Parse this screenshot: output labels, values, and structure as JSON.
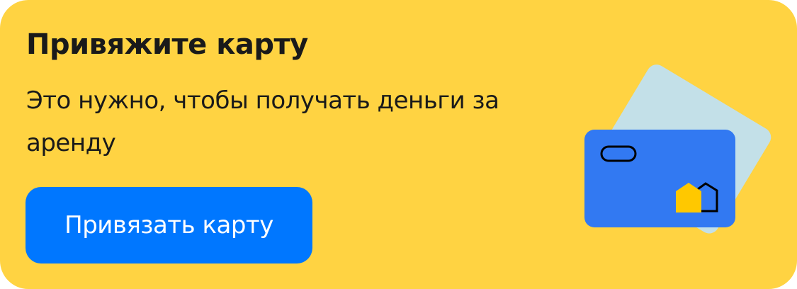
{
  "banner": {
    "title": "Привяжите карту",
    "subtitle": "Это нужно, чтобы получать деньги за аренду",
    "button_label": "Привязать карту"
  },
  "colors": {
    "background": "#FFD342",
    "button": "#0077FF",
    "card_front": "#3279F2",
    "card_back": "#C3E0E8",
    "house": "#FFC800"
  },
  "illustration": {
    "icon": "bank-cards-with-house-logo"
  }
}
